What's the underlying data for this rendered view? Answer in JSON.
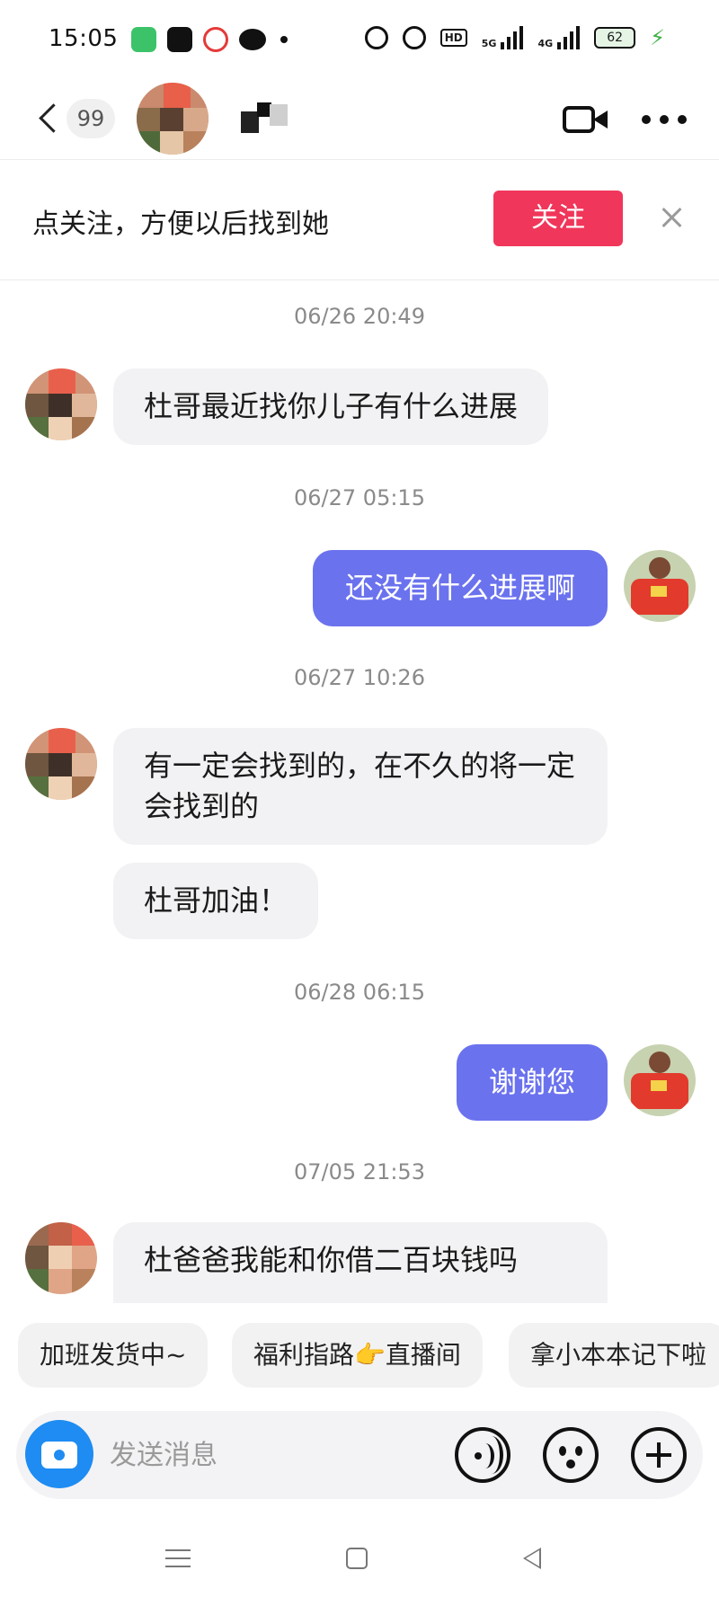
{
  "status_bar": {
    "time": "15:05",
    "app_icons": [
      "messages-icon",
      "tiktok-icon",
      "map-icon",
      "wechat-icon"
    ],
    "hd_label": "HD",
    "signal_1_label": "5G",
    "signal_2_label": "4G",
    "battery_level": "62"
  },
  "header": {
    "unread_count": "99",
    "icons": [
      "back-arrow-icon",
      "video-call-icon",
      "more-icon"
    ]
  },
  "follow_bar": {
    "text": "点关注，方便以后找到她",
    "button_label": "关注",
    "accent_color": "#f0365a"
  },
  "messages": [
    {
      "type": "timestamp",
      "text": "06/26 20:49"
    },
    {
      "type": "incoming",
      "text": "杜哥最近找你儿子有什么进展"
    },
    {
      "type": "timestamp",
      "text": "06/27 05:15"
    },
    {
      "type": "outgoing",
      "text": "还没有什么进展啊"
    },
    {
      "type": "timestamp",
      "text": "06/27 10:26"
    },
    {
      "type": "incoming",
      "text": "有一定会找到的，在不久的将一定会找到的"
    },
    {
      "type": "incoming",
      "text": "杜哥加油！"
    },
    {
      "type": "timestamp",
      "text": "06/28 06:15"
    },
    {
      "type": "outgoing",
      "text": "谢谢您"
    },
    {
      "type": "timestamp",
      "text": "07/05 21:53"
    },
    {
      "type": "incoming",
      "text": "杜爸爸我能和你借二百块钱吗"
    }
  ],
  "bubble_colors": {
    "outgoing": "#6b72ee",
    "incoming": "#f2f2f4"
  },
  "quick_replies": [
    "加班发货中~",
    "福利指路👉直播间",
    "拿小本本记下啦"
  ],
  "input": {
    "placeholder": "发送消息",
    "value": ""
  },
  "nav": {
    "icons": [
      "menu-icon",
      "home-icon",
      "back-icon"
    ]
  }
}
